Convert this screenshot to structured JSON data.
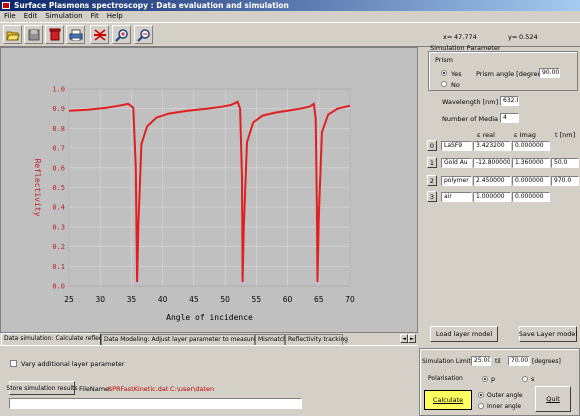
{
  "window": {
    "title": "Surface Plasmons spectroscopy : Data evaluation and simulation"
  },
  "menu": [
    "File",
    "Edit",
    "Simulation",
    "Fit",
    "Help"
  ],
  "toolbar": {
    "icons": [
      "open-folder-icon",
      "save-disk-icon",
      "delete-icon",
      "print-icon",
      "layer-stack-icon",
      "zoom-in-icon",
      "zoom-reset-icon"
    ]
  },
  "coords": {
    "x_label": "x=",
    "x_value": "47.774",
    "y_label": "y=",
    "y_value": "0.524"
  },
  "chart_data": {
    "type": "line",
    "xlabel": "Angle of incidence",
    "ylabel": "Reflectivity",
    "xlim": [
      25,
      70
    ],
    "ylim": [
      0,
      1.0
    ],
    "xticks": [
      "25",
      "30",
      "35",
      "40",
      "45",
      "50",
      "55",
      "60",
      "65",
      "70"
    ],
    "yticks": [
      "0.0",
      "0.1",
      "0.2",
      "0.3",
      "0.4",
      "0.5",
      "0.6",
      "0.7",
      "0.8",
      "0.9",
      "1.0"
    ],
    "grid": true,
    "series": [
      {
        "color": "#e02020",
        "points": [
          [
            25,
            0.89
          ],
          [
            28,
            0.895
          ],
          [
            31,
            0.905
          ],
          [
            33,
            0.915
          ],
          [
            34.5,
            0.925
          ],
          [
            35.3,
            0.905
          ],
          [
            35.7,
            0.6
          ],
          [
            35.9,
            0.02
          ],
          [
            36.1,
            0.3
          ],
          [
            36.6,
            0.72
          ],
          [
            37.5,
            0.81
          ],
          [
            39,
            0.855
          ],
          [
            41,
            0.875
          ],
          [
            44,
            0.89
          ],
          [
            47,
            0.9
          ],
          [
            49.5,
            0.91
          ],
          [
            51,
            0.92
          ],
          [
            52,
            0.935
          ],
          [
            52.4,
            0.9
          ],
          [
            52.7,
            0.55
          ],
          [
            52.8,
            0.02
          ],
          [
            53,
            0.3
          ],
          [
            53.5,
            0.73
          ],
          [
            54.5,
            0.83
          ],
          [
            56,
            0.865
          ],
          [
            58,
            0.88
          ],
          [
            60,
            0.89
          ],
          [
            62,
            0.9
          ],
          [
            63.5,
            0.91
          ],
          [
            64.2,
            0.925
          ],
          [
            64.5,
            0.85
          ],
          [
            64.7,
            0.4
          ],
          [
            64.8,
            0.02
          ],
          [
            65,
            0.35
          ],
          [
            65.5,
            0.78
          ],
          [
            66.5,
            0.87
          ],
          [
            68,
            0.9
          ],
          [
            70,
            0.915
          ]
        ]
      }
    ]
  },
  "right": {
    "sim_param_title": "Simulation Parameter",
    "prism_title": "Prism",
    "yes": "Yes",
    "no": "No",
    "prism_angle_label": "Prism angle [degree]",
    "prism_angle": "90.00",
    "wavelength_label": "Wavelength [nm]",
    "wavelength": "632.8",
    "media_label": "Number of Media",
    "media": "4",
    "col_e_real": "ε real",
    "col_e_imag": "ε Imag",
    "col_t": "t [nm]",
    "layers": [
      {
        "idx": "0",
        "name": "LaSF9",
        "er": "3.423200",
        "ei": "0.000000",
        "t": ""
      },
      {
        "idx": "1",
        "name": "Gold Au",
        "er": "-12.800000",
        "ei": "1.360000",
        "t": "50.0"
      },
      {
        "idx": "2",
        "name": "polymer",
        "er": "2.450000",
        "ei": "0.000000",
        "t": "970.0"
      },
      {
        "idx": "3",
        "name": "air",
        "er": "1.000000",
        "ei": "0.000000",
        "t": ""
      }
    ],
    "load_btn": "Load layer model",
    "store_btn": "Save Layer model",
    "sim_limits_label": "Simulation Limits",
    "lim_from": "25.00",
    "til": "til",
    "lim_to": "70.00",
    "deg": "[degrees]",
    "polarisation": "Polarisation",
    "p": "p",
    "s": "s",
    "calculate": "Calculate",
    "outer": "Outer angle",
    "inner": "Inner angle",
    "quit": "Quit"
  },
  "tabs": [
    "Data simulation: Calculate reflectivity",
    "Data Modeling: Adjust layer parameter to measured data",
    "Mismatch",
    "Reflectivity tracking"
  ],
  "bottom": {
    "vary_label": "Vary additional layer parameter",
    "store_results": "Store simulation results",
    "filename_label": "FileName:",
    "filename": "SPRFastKinetic.dat",
    "path": "C:\\user\\daten"
  }
}
